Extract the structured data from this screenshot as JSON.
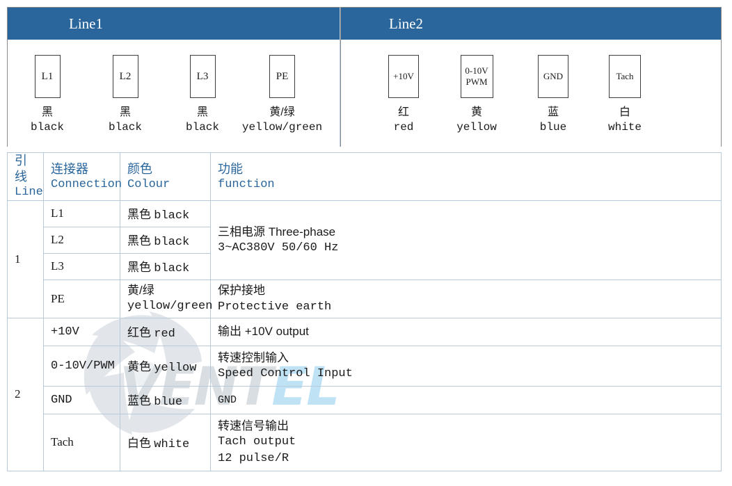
{
  "panels": [
    {
      "title": "Line1",
      "connectors": [
        {
          "box_label": "L1",
          "box_label2": "",
          "colour_cn": "黑",
          "colour_en": "black"
        },
        {
          "box_label": "L2",
          "box_label2": "",
          "colour_cn": "黑",
          "colour_en": "black"
        },
        {
          "box_label": "L3",
          "box_label2": "",
          "colour_cn": "黑",
          "colour_en": "black"
        },
        {
          "box_label": "PE",
          "box_label2": "",
          "colour_cn": "黄/绿",
          "colour_en": "yellow/green"
        }
      ]
    },
    {
      "title": "Line2",
      "connectors": [
        {
          "box_label": "+10V",
          "box_label2": "",
          "colour_cn": "红",
          "colour_en": "red"
        },
        {
          "box_label": "0-10V",
          "box_label2": "PWM",
          "colour_cn": "黄",
          "colour_en": "yellow"
        },
        {
          "box_label": "GND",
          "box_label2": "",
          "colour_cn": "蓝",
          "colour_en": "blue"
        },
        {
          "box_label": "Tach",
          "box_label2": "",
          "colour_cn": "白",
          "colour_en": "white"
        }
      ]
    }
  ],
  "table": {
    "headers": [
      {
        "cn": "引线",
        "en": "Line"
      },
      {
        "cn": "连接器",
        "en": "Connection"
      },
      {
        "cn": "颜色",
        "en": "Colour"
      },
      {
        "cn": "功能",
        "en": "function"
      }
    ],
    "groups": [
      {
        "line": "1",
        "rows": [
          {
            "connection": "L1",
            "colour_cn": "黑色",
            "colour_en": "black"
          },
          {
            "connection": "L2",
            "colour_cn": "黑色",
            "colour_en": "black"
          },
          {
            "connection": "L3",
            "colour_cn": "黑色",
            "colour_en": "black"
          },
          {
            "connection": "PE",
            "colour_cn": "黄/绿",
            "colour_en": "yellow/green",
            "function_cn": "保护接地",
            "function_en": "Protective earth"
          }
        ],
        "function_cn": "三相电源 Three-phase",
        "function_en": "3~AC380V 50/60 Hz"
      },
      {
        "line": "2",
        "rows": [
          {
            "connection": "+10V",
            "colour_cn": "红色",
            "colour_en": "red",
            "function_cn": "输出 +10V output",
            "function_en": ""
          },
          {
            "connection": "0-10V/PWM",
            "colour_cn": "黄色",
            "colour_en": "yellow",
            "function_cn": "转速控制输入",
            "function_en": "Speed Control Input"
          },
          {
            "connection": "GND",
            "colour_cn": "蓝色",
            "colour_en": "blue",
            "function_cn": "GND",
            "function_en": ""
          },
          {
            "connection": "Tach",
            "colour_cn": "白色",
            "colour_en": "white",
            "function_cn": "转速信号输出",
            "function_en": "Tach output",
            "function_en2": "12 pulse/R"
          }
        ]
      }
    ]
  },
  "watermark": {
    "text_a": "VENT",
    "text_b": "EL"
  },
  "colors": {
    "header_blue": "#2a669c",
    "grid": "#b8c9d9",
    "border": "#5a5a5a"
  }
}
